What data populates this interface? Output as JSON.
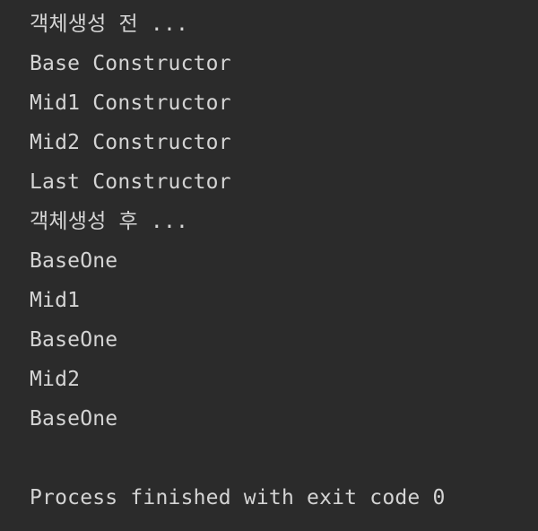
{
  "console": {
    "lines": [
      "객체생성 전 ...",
      "Base Constructor",
      "Mid1 Constructor",
      "Mid2 Constructor",
      "Last Constructor",
      "객체생성 후 ...",
      "BaseOne",
      "Mid1",
      "BaseOne",
      "Mid2",
      "BaseOne",
      "",
      "Process finished with exit code 0"
    ]
  },
  "colors": {
    "background": "#2b2b2b",
    "text": "#d4d4d4"
  }
}
